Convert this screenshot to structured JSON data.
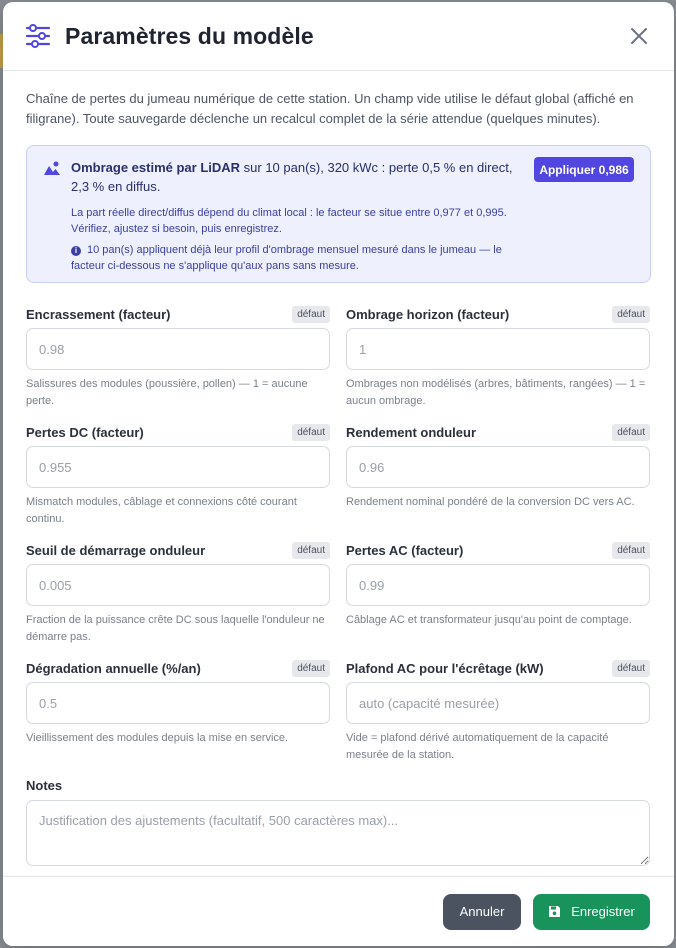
{
  "modal": {
    "title": "Paramètres du modèle",
    "intro": "Chaîne de pertes du jumeau numérique de cette station. Un champ vide utilise le défaut global (affiché en filigrane). Toute sauvegarde déclenche un recalcul complet de la série attendue (quelques minutes)."
  },
  "lidar": {
    "bold": "Ombrage estimé par LiDAR",
    "rest": " sur 10 pan(s), 320 kWc : perte 0,5 % en direct, 2,3 % en diffus.",
    "apply_label": "Appliquer 0,986",
    "note": "La part réelle direct/diffus dépend du climat local : le facteur se situe entre 0,977 et 0,995. Vérifiez, ajustez si besoin, puis enregistrez.",
    "info_glyph": "i",
    "info": "10 pan(s) appliquent déjà leur profil d'ombrage mensuel mesuré dans le jumeau — le facteur ci-dessous ne s'applique qu'aux pans sans mesure.",
    "accent": "#5147e0"
  },
  "default_badge": "défaut",
  "fields": [
    {
      "label": "Encrassement (facteur)",
      "placeholder": "0.98",
      "hint": "Salissures des modules (poussière, pollen) — 1 = aucune perte.",
      "badge": true
    },
    {
      "label": "Ombrage horizon (facteur)",
      "placeholder": "1",
      "hint": "Ombrages non modélisés (arbres, bâtiments, rangées) — 1 = aucun ombrage.",
      "badge": true
    },
    {
      "label": "Pertes DC (facteur)",
      "placeholder": "0.955",
      "hint": "Mismatch modules, câblage et connexions côté courant continu.",
      "badge": true
    },
    {
      "label": "Rendement onduleur",
      "placeholder": "0.96",
      "hint": "Rendement nominal pondéré de la conversion DC vers AC.",
      "badge": true
    },
    {
      "label": "Seuil de démarrage onduleur",
      "placeholder": "0.005",
      "hint": "Fraction de la puissance crête DC sous laquelle l'onduleur ne démarre pas.",
      "badge": true
    },
    {
      "label": "Pertes AC (facteur)",
      "placeholder": "0.99",
      "hint": "Câblage AC et transformateur jusqu'au point de comptage.",
      "badge": true
    },
    {
      "label": "Dégradation annuelle (%/an)",
      "placeholder": "0.5",
      "hint": "Vieillissement des modules depuis la mise en service.",
      "badge": true
    },
    {
      "label": "Plafond AC pour l'écrêtage (kW)",
      "placeholder": "auto (capacité mesurée)",
      "hint": "Vide = plafond dérivé automatiquement de la capacité mesurée de la station.",
      "badge": true
    }
  ],
  "notes": {
    "label": "Notes",
    "placeholder": "Justification des ajustements (facultatif, 500 caractères max)..."
  },
  "footer": {
    "cancel_label": "Annuler",
    "save_label": "Enregistrer",
    "save_color": "#17935b"
  }
}
